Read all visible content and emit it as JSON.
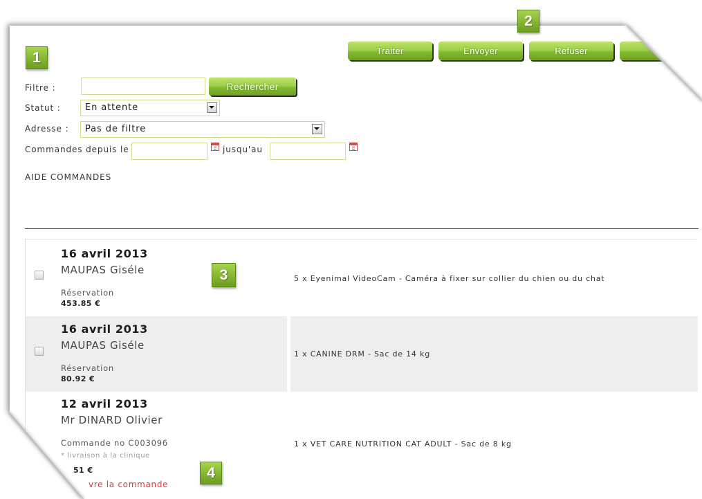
{
  "markers": [
    "1",
    "2",
    "3",
    "4"
  ],
  "toolbar": {
    "process_label": "Traiter",
    "send_label": "Envoyer",
    "refuse_label": "Refuser"
  },
  "filters": {
    "filter_label": "Filtre :",
    "search_button": "Rechercher",
    "status_label": "Statut :",
    "status_value": "En attente",
    "address_label": "Adresse :",
    "address_value": "Pas de filtre",
    "date_from_label": "Commandes depuis le",
    "date_to_label": "jusqu'au"
  },
  "help": {
    "label": "AIDE COMMANDES"
  },
  "orders": [
    {
      "date": "16 avril 2013",
      "customer": "MAUPAS Giséle",
      "type": "Réservation",
      "total": "453.85 €",
      "items": "5 x Eyenimal VideoCam - Caméra à fixer sur collier du chien ou du chat"
    },
    {
      "date": "16 avril 2013",
      "customer": "MAUPAS Giséle",
      "type": "Réservation",
      "total": "80.92 €",
      "items": "1 x CANINE DRM - Sac de 14 kg"
    },
    {
      "date": "12 avril 2013",
      "customer": "Mr DINARD Olivier",
      "type": "Commande no C003096",
      "delivery_note": "* livraison à la clinique",
      "total": "51 €",
      "link": "vre la commande",
      "items": "1 x VET CARE NUTRITION CAT ADULT - Sac de 8 kg"
    }
  ],
  "icons": {
    "status_dropdown": "chevron-down-icon",
    "address_dropdown": "chevron-down-icon",
    "date_from_picker": "calendar-icon",
    "date_to_picker": "calendar-icon",
    "row_select": "checkbox"
  },
  "colors": {
    "accent_green": "#8cc63f",
    "button_shadow": "#2f2f2f",
    "input_border": "#d6dc8e",
    "alt_row_bg": "#eeeeee",
    "link_red": "#d23b3b"
  }
}
